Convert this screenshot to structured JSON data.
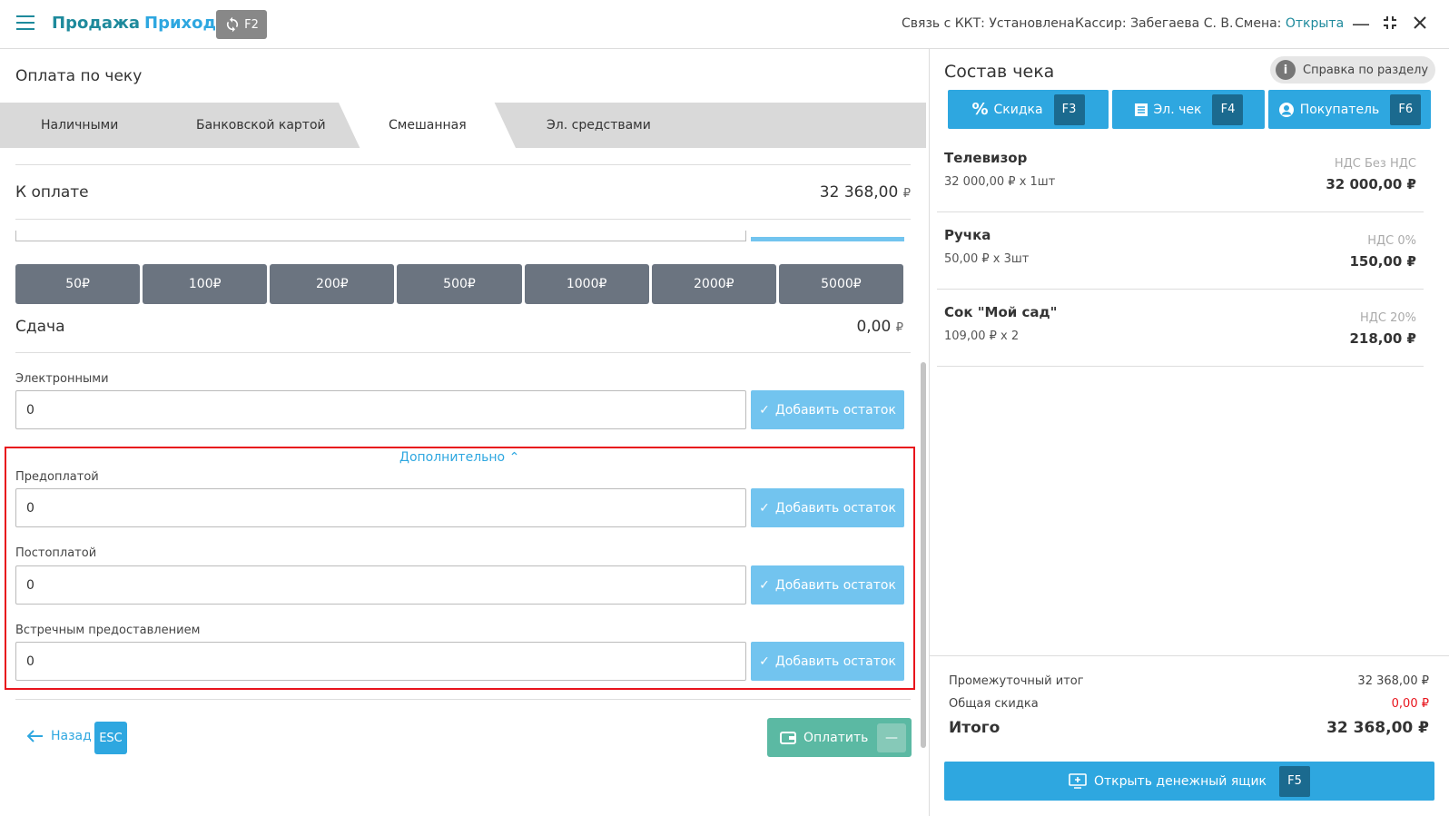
{
  "topbar": {
    "tab_sale": "Продажа",
    "tab_income": "Приход",
    "sync_key": "F2",
    "kkt_status_label": "Связь с ККТ:",
    "kkt_status_value": "Установлена",
    "cashier": "Кассир: Забегаева С. В.",
    "shift_label": "Смена:",
    "shift_value": "Открыта"
  },
  "payment": {
    "title": "Оплата по чеку",
    "tabs": [
      "Наличными",
      "Банковской картой",
      "Смешанная",
      "Эл. средствами"
    ],
    "active_tab": "Смешанная",
    "to_pay_label": "К оплате",
    "to_pay_value": "32 368,00",
    "currency": "₽",
    "denominations": [
      "50₽",
      "100₽",
      "200₽",
      "500₽",
      "1000₽",
      "2000₽",
      "5000₽"
    ],
    "change_label": "Сдача",
    "change_value": "0,00",
    "electronic_label": "Электронными",
    "electronic_value": "0",
    "add_rest_label": "Добавить остаток",
    "more_label": "Дополнительно",
    "prepay_label": "Предоплатой",
    "prepay_value": "0",
    "postpay_label": "Постоплатой",
    "postpay_value": "0",
    "counter_label": "Встречным предоставлением",
    "counter_value": "0",
    "back_label": "Назад",
    "back_key": "ESC",
    "pay_label": "Оплатить",
    "pay_key": "—"
  },
  "receipt": {
    "title": "Состав чека",
    "help_label": "Справка по разделу",
    "discount_label": "Скидка",
    "discount_key": "F3",
    "echeck_label": "Эл. чек",
    "echeck_key": "F4",
    "buyer_label": "Покупатель",
    "buyer_key": "F6",
    "items": [
      {
        "name": "Телевизор",
        "qty": "32 000,00 ₽ x 1шт",
        "vat": "НДС Без НДС",
        "sum": "32 000,00 ₽"
      },
      {
        "name": "Ручка",
        "qty": "50,00 ₽ x 3шт",
        "vat": "НДС 0%",
        "sum": "150,00 ₽"
      },
      {
        "name": "Сок \"Мой сад\"",
        "qty": "109,00 ₽ x 2",
        "vat": "НДС 20%",
        "sum": "218,00 ₽"
      }
    ],
    "subtotal_label": "Промежуточный итог",
    "subtotal_value": "32 368,00 ₽",
    "discount_total_label": "Общая скидка",
    "discount_total_value": "0,00 ₽",
    "total_label": "Итого",
    "total_value": "32 368,00 ₽",
    "drawer_label": "Открыть денежный ящик",
    "drawer_key": "F5"
  },
  "colors": {
    "accent": "#2ea7e0",
    "brand_teal": "#1e8a9c",
    "pay_green": "#5bb9a3",
    "highlight_red": "#e8141c"
  }
}
